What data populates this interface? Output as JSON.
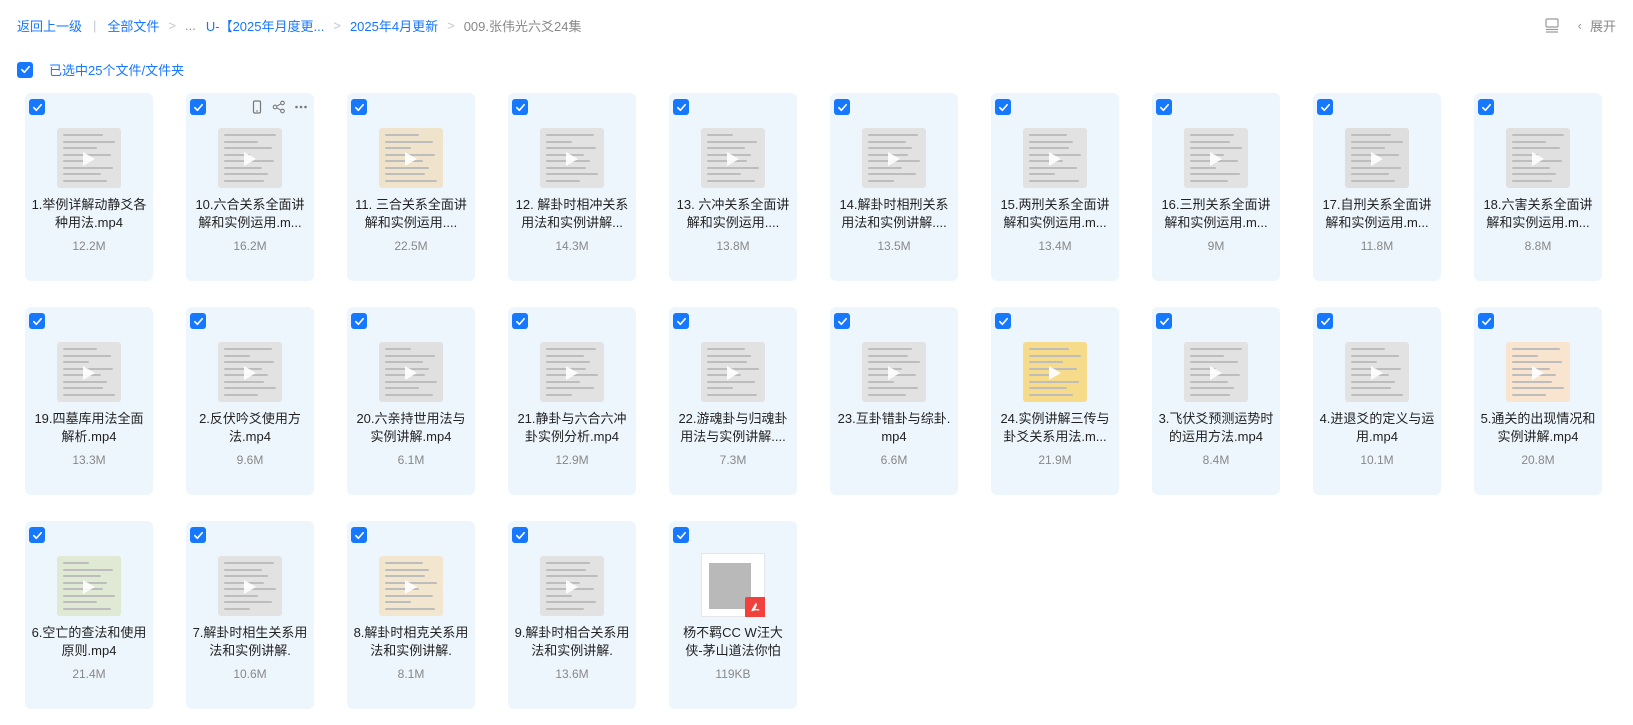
{
  "breadcrumb": {
    "back": "返回上一级",
    "all_files": "全部文件",
    "ellipsis": "...",
    "folder1": "U-【2025年月度更...",
    "folder2": "2025年4月更新",
    "current": "009.张伟光六爻24集"
  },
  "toolbar": {
    "expand_label": "展开"
  },
  "selection": {
    "text": "已选中25个文件/文件夹"
  },
  "colors": {
    "accent": "#1677ff",
    "tile_bg": "#eef6fd"
  },
  "files": [
    {
      "name": "1.举例详解动静爻各种用法.mp4",
      "size": "12.2M",
      "thumb": "#e2e2e2"
    },
    {
      "name": "10.六合关系全面讲解和实例运用.m...",
      "size": "16.2M",
      "thumb": "#e2e2e2"
    },
    {
      "name": "11. 三合关系全面讲解和实例运用....",
      "size": "22.5M",
      "thumb": "#efe3cb"
    },
    {
      "name": "12. 解卦时相冲关系用法和实例讲解...",
      "size": "14.3M",
      "thumb": "#e2e2e2"
    },
    {
      "name": "13. 六冲关系全面讲解和实例运用....",
      "size": "13.8M",
      "thumb": "#e2e2e2"
    },
    {
      "name": "14.解卦时相刑关系用法和实例讲解....",
      "size": "13.5M",
      "thumb": "#e2e2e2"
    },
    {
      "name": "15.两刑关系全面讲解和实例运用.m...",
      "size": "13.4M",
      "thumb": "#e2e2e2"
    },
    {
      "name": "16.三刑关系全面讲解和实例运用.m...",
      "size": "9M",
      "thumb": "#e2e2e2"
    },
    {
      "name": "17.自刑关系全面讲解和实例运用.m...",
      "size": "11.8M",
      "thumb": "#dedede"
    },
    {
      "name": "18.六害关系全面讲解和实例运用.m...",
      "size": "8.8M",
      "thumb": "#e0e0e0"
    },
    {
      "name": "19.四墓库用法全面解析.mp4",
      "size": "13.3M",
      "thumb": "#e2e2e2"
    },
    {
      "name": "2.反伏吟爻使用方法.mp4",
      "size": "9.6M",
      "thumb": "#e2e2e2"
    },
    {
      "name": "20.六亲持世用法与实例讲解.mp4",
      "size": "6.1M",
      "thumb": "#e0e0e0"
    },
    {
      "name": "21.静卦与六合六冲卦实例分析.mp4",
      "size": "12.9M",
      "thumb": "#e2e2e2"
    },
    {
      "name": "22.游魂卦与归魂卦用法与实例讲解....",
      "size": "7.3M",
      "thumb": "#e2e2e2"
    },
    {
      "name": "23.互卦错卦与综卦.mp4",
      "size": "6.6M",
      "thumb": "#e2e2e2"
    },
    {
      "name": "24.实例讲解三传与卦爻关系用法.m...",
      "size": "21.9M",
      "thumb": "#f6dc8a"
    },
    {
      "name": "3.飞伏爻预测运势时的运用方法.mp4",
      "size": "8.4M",
      "thumb": "#e2e2e2"
    },
    {
      "name": "4.进退爻的定义与运用.mp4",
      "size": "10.1M",
      "thumb": "#e2e2e2"
    },
    {
      "name": "5.通关的出现情况和实例讲解.mp4",
      "size": "20.8M",
      "thumb": "#f8e4cf"
    },
    {
      "name": "6.空亡的查法和使用原则.mp4",
      "size": "21.4M",
      "thumb": "#dfe9d3"
    },
    {
      "name": "7.解卦时相生关系用法和实例讲解.",
      "size": "10.6M",
      "thumb": "#e2e2e2"
    },
    {
      "name": "8.解卦时相克关系用法和实例讲解.",
      "size": "8.1M",
      "thumb": "#f3e6cf"
    },
    {
      "name": "9.解卦时相合关系用法和实例讲解.",
      "size": "13.6M",
      "thumb": "#e2e2e2"
    },
    {
      "name": "杨不羁CC W汪大侠-茅山道法你怕",
      "size": "119KB",
      "thumb": "pdf"
    }
  ]
}
